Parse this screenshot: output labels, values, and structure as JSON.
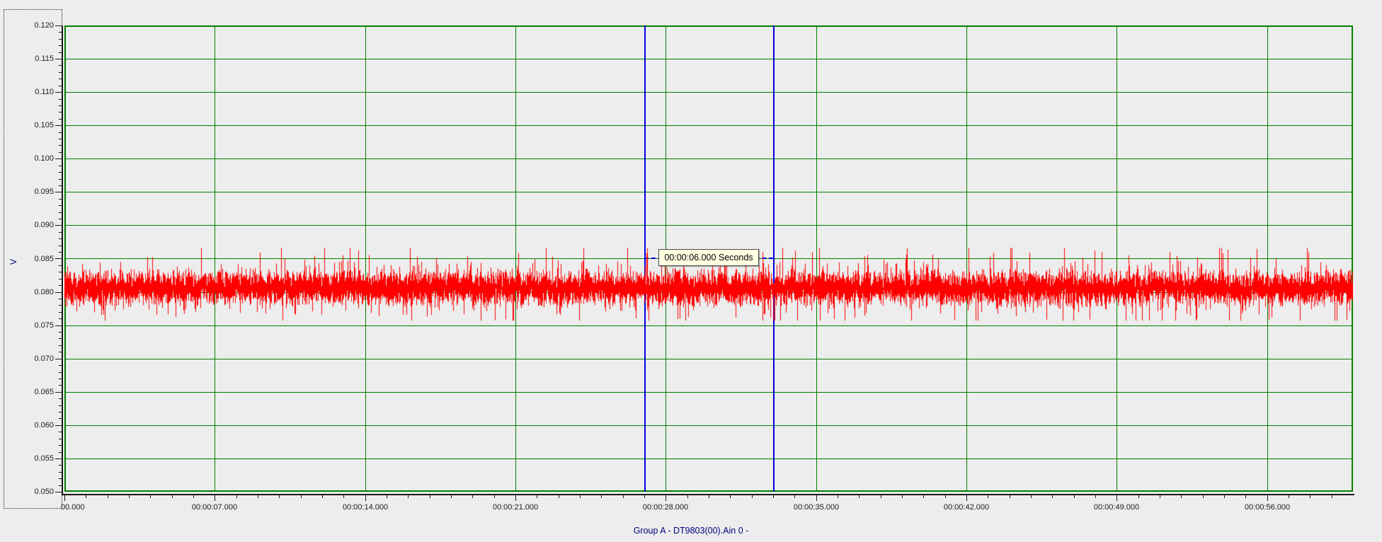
{
  "window": {
    "background": "#ededed"
  },
  "chart_data": {
    "type": "line",
    "title": "",
    "xlabel": "",
    "ylabel": "V",
    "grid": true,
    "grid_color": "#008000",
    "plot_border_color": "#008000",
    "y_axis": {
      "unit": "V",
      "min": 0.05,
      "max": 0.12,
      "major_step": 0.005,
      "minor_step": 0.001,
      "tick_labels": [
        "0.120",
        "0.115",
        "0.110",
        "0.105",
        "0.100",
        "0.095",
        "0.090",
        "0.085",
        "0.080",
        "0.075",
        "0.070",
        "0.065",
        "0.060",
        "0.055",
        "0.050"
      ]
    },
    "x_axis": {
      "unit": "Seconds",
      "min_seconds": 0,
      "max_seconds": 60,
      "major_step_seconds": 7,
      "minor_step_seconds": 1,
      "tick_seconds": [
        0,
        7,
        14,
        21,
        28,
        35,
        42,
        49,
        56
      ],
      "tick_labels": [
        "00.000",
        "00:00:07.000",
        "00:00:14.000",
        "00:00:21.000",
        "00:00:28.000",
        "00:00:35.000",
        "00:00:42.000",
        "00:00:49.000",
        "00:00:56.000"
      ]
    },
    "series": [
      {
        "name": "Group A - DT9803(00).Ain 0 -",
        "color": "#ff0000",
        "signal": "random noise",
        "mean_v": 0.0806,
        "dense_band_v": [
          0.079,
          0.0835
        ],
        "spike_max_v": 0.0866,
        "spike_min_v": 0.0757
      }
    ],
    "cursors": {
      "color": "#0000e0",
      "positions_seconds": [
        27,
        33
      ],
      "delta_seconds": 6,
      "delta_line_v": 0.085,
      "delta_label": "00:00:06.000 Seconds"
    }
  },
  "tooltip": {
    "text": "00:00:06.000 Seconds",
    "background": "#ffffe1"
  },
  "legend": {
    "text": "Group A - DT9803(00).Ain 0 -",
    "color": "#000080"
  }
}
